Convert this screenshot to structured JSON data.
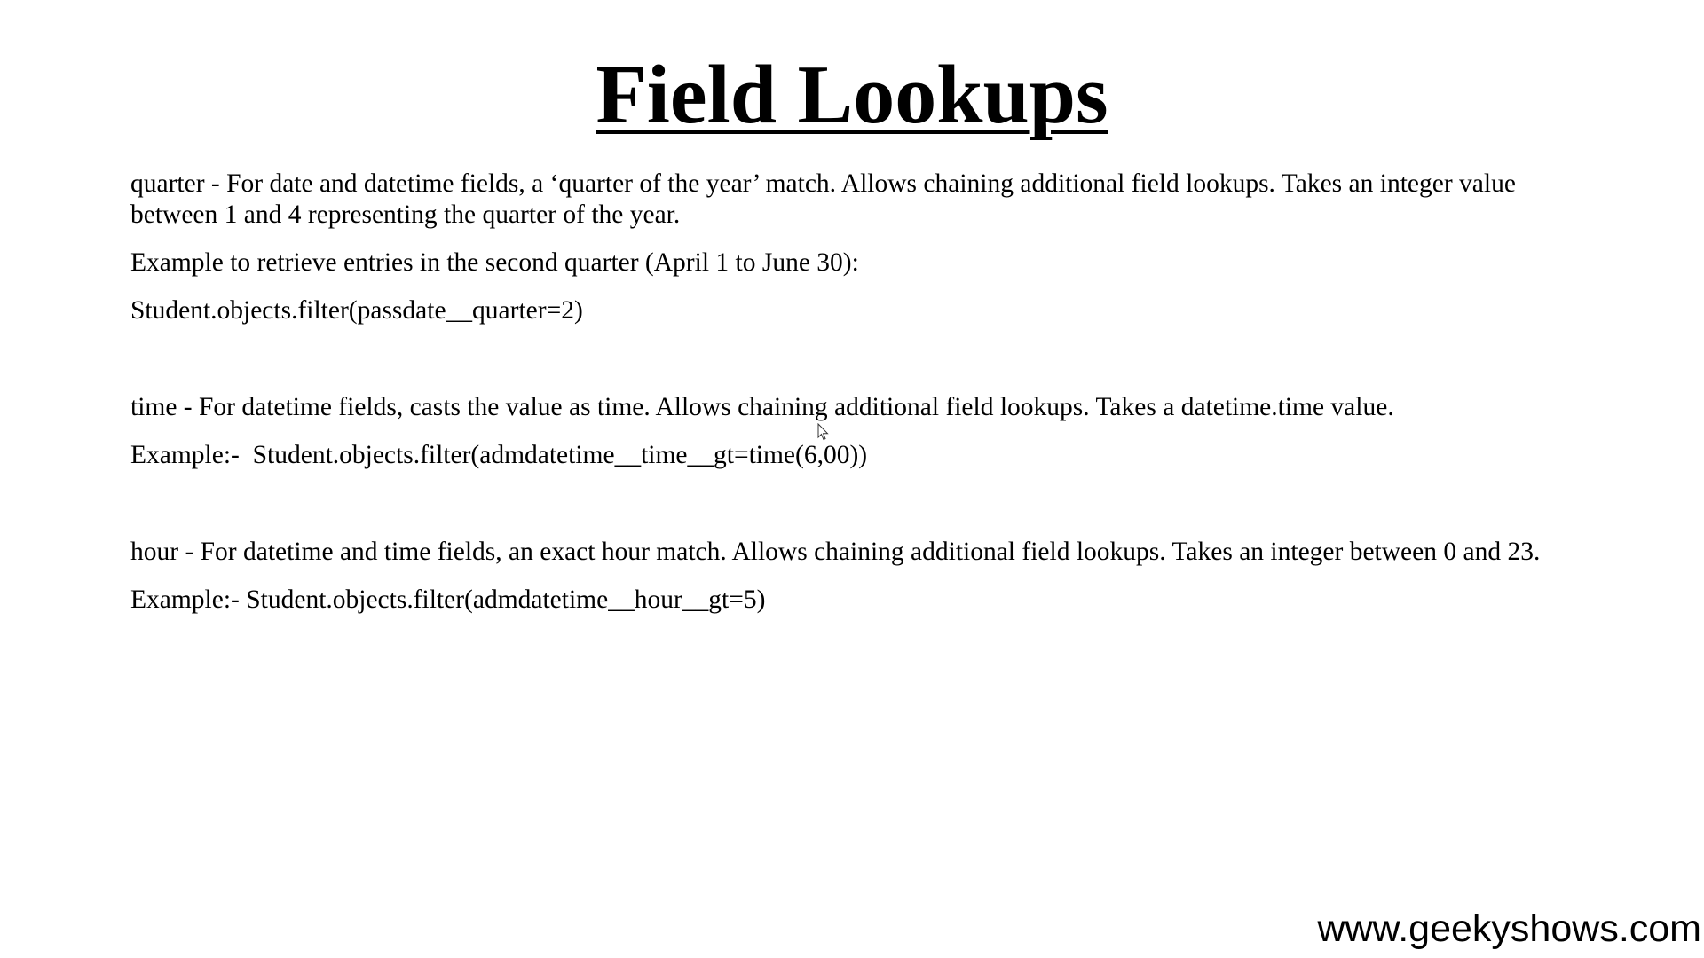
{
  "slide": {
    "title": "Field Lookups",
    "paragraphs": {
      "quarter_desc": "quarter - For date and datetime fields, a ‘quarter of the year’ match. Allows chaining additional field lookups. Takes an integer value between 1 and 4 representing the quarter of the year.",
      "quarter_example_intro": "Example to retrieve entries in the second quarter (April 1 to June 30):",
      "quarter_example_code": "Student.objects.filter(passdate__quarter=2)",
      "time_desc": "time - For datetime fields, casts the value as time. Allows chaining additional field lookups. Takes a datetime.time value.",
      "time_example": "Example:-  Student.objects.filter(admdatetime__time__gt=time(6,00))",
      "hour_desc": "hour - For datetime and time fields, an exact hour match. Allows chaining additional field lookups. Takes an integer between 0 and 23.",
      "hour_example": "Example:- Student.objects.filter(admdatetime__hour__gt=5)"
    },
    "footer": "www.geekyshows.com"
  },
  "icons": {
    "cursor": "mouse-pointer-icon"
  }
}
